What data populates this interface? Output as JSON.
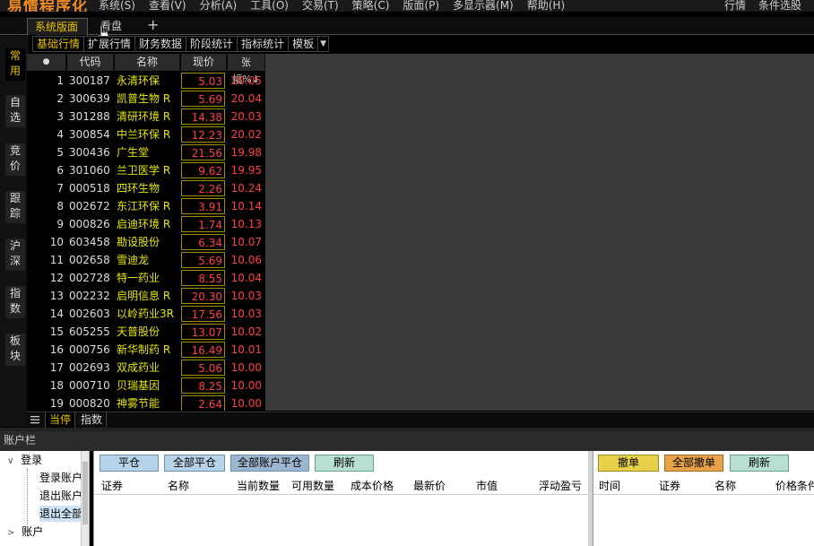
{
  "app": {
    "logo": "易情程序化"
  },
  "menu": {
    "items": [
      "系统(S)",
      "查看(V)",
      "分析(A)",
      "工具(O)",
      "交易(T)",
      "策略(C)",
      "版面(P)",
      "多显示器(M)",
      "帮助(H)"
    ],
    "right": [
      "行情",
      "条件选股",
      "条"
    ]
  },
  "tabs": {
    "active": "系统版面",
    "other": "看盘",
    "close": "×",
    "add": "+"
  },
  "subtabs": [
    "基础行情",
    "扩展行情",
    "财务数据",
    "阶段统计",
    "指标统计",
    "模板"
  ],
  "subtab_dropdown": "▼",
  "vtabs": [
    "常用",
    "自选",
    "竞价",
    "跟踪",
    "沪深",
    "指数",
    "板块"
  ],
  "table": {
    "headers": {
      "dot": "●",
      "code": "代码",
      "name": "名称",
      "price": "现价",
      "pct": "张幅%↓"
    },
    "rows": [
      {
        "idx": "1",
        "code": "300187",
        "name": "永清环保",
        "price": "5.03",
        "pct": "20.05"
      },
      {
        "idx": "2",
        "code": "300639",
        "name": "凯普生物  R",
        "price": "5.69",
        "pct": "20.04"
      },
      {
        "idx": "3",
        "code": "301288",
        "name": "清研环境  R",
        "price": "14.38",
        "pct": "20.03"
      },
      {
        "idx": "4",
        "code": "300854",
        "name": "中兰环保  R",
        "price": "12.23",
        "pct": "20.02"
      },
      {
        "idx": "5",
        "code": "300436",
        "name": "广生堂",
        "price": "21.56",
        "pct": "19.98"
      },
      {
        "idx": "6",
        "code": "301060",
        "name": "兰卫医学  R",
        "price": "9.62",
        "pct": "19.95"
      },
      {
        "idx": "7",
        "code": "000518",
        "name": "四环生物",
        "price": "2.26",
        "pct": "10.24"
      },
      {
        "idx": "8",
        "code": "002672",
        "name": "东江环保  R",
        "price": "3.91",
        "pct": "10.14"
      },
      {
        "idx": "9",
        "code": "000826",
        "name": "启迪环境  R",
        "price": "1.74",
        "pct": "10.13"
      },
      {
        "idx": "10",
        "code": "603458",
        "name": "勘设股份",
        "price": "6.34",
        "pct": "10.07"
      },
      {
        "idx": "11",
        "code": "002658",
        "name": "雪迪龙",
        "price": "5.69",
        "pct": "10.06"
      },
      {
        "idx": "12",
        "code": "002728",
        "name": "特一药业",
        "price": "8.55",
        "pct": "10.04"
      },
      {
        "idx": "13",
        "code": "002232",
        "name": "启明信息  R",
        "price": "20.30",
        "pct": "10.03"
      },
      {
        "idx": "14",
        "code": "002603",
        "name": "以岭药业3R",
        "price": "17.56",
        "pct": "10.03"
      },
      {
        "idx": "15",
        "code": "605255",
        "name": "天普股份",
        "price": "13.07",
        "pct": "10.02"
      },
      {
        "idx": "16",
        "code": "000756",
        "name": "新华制药  R",
        "price": "16.49",
        "pct": "10.01"
      },
      {
        "idx": "17",
        "code": "002693",
        "name": "双成药业",
        "price": "5.06",
        "pct": "10.00"
      },
      {
        "idx": "18",
        "code": "000710",
        "name": "贝瑞基因",
        "price": "8.25",
        "pct": "10.00"
      },
      {
        "idx": "19",
        "code": "000820",
        "name": "神雾节能",
        "price": "2.64",
        "pct": "10.00"
      }
    ]
  },
  "grid_footer": {
    "tab_active": "当停",
    "tab_other": "指数"
  },
  "account_bar": {
    "title": "账户栏",
    "tree": {
      "login_group": "登录",
      "items": [
        "登录账户",
        "退出账户",
        "退出全部"
      ],
      "account_group": "账户",
      "expand_open": "∨",
      "expand_closed": ">"
    },
    "positions": {
      "buttons": [
        "平仓",
        "全部平仓",
        "全部账户平仓",
        "刷新"
      ],
      "columns": [
        "证券",
        "名称",
        "当前数量",
        "可用数量",
        "成本价格",
        "最新价",
        "市值",
        "浮动盈亏"
      ]
    },
    "orders": {
      "buttons": [
        "撤单",
        "全部撤单",
        "刷新"
      ],
      "columns": [
        "时间",
        "证券",
        "名称",
        "价格条件"
      ]
    }
  },
  "colors": {
    "accent": "#e6c300",
    "up": "#ff4040",
    "logo": "#f08a24"
  }
}
